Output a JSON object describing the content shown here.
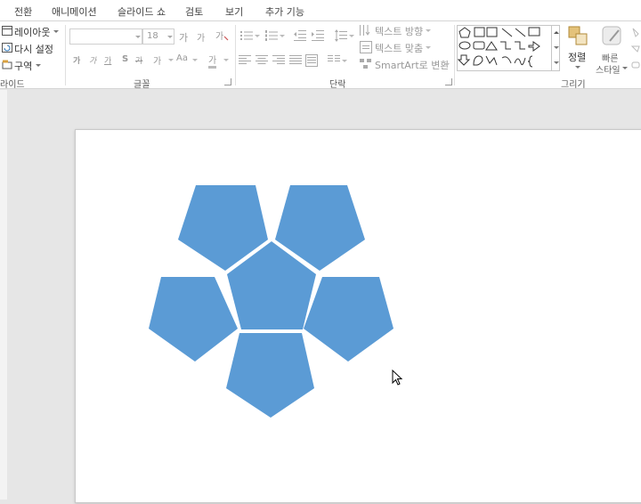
{
  "tabs": [
    "전환",
    "애니메이션",
    "슬라이드 쇼",
    "검토",
    "보기",
    "추가 기능"
  ],
  "ribbon": {
    "slides": {
      "layout": "레이아웃",
      "reset": "다시 설정",
      "section": "구역",
      "group_label": "라이드"
    },
    "font": {
      "font_size": "18",
      "grow_label": "가",
      "shrink_label": "가",
      "bold": "가",
      "italic": "가",
      "underline": "가",
      "shadow": "S",
      "strike": "가",
      "spacing": "가",
      "change_case": "Aa",
      "color": "가",
      "group_label": "글꼴"
    },
    "paragraph": {
      "text_direction": "텍스트 방향",
      "align_text": "텍스트 맞춤",
      "smartart": "SmartArt로 변환",
      "group_label": "단락"
    },
    "drawing": {
      "arrange": "정렬",
      "quick_styles": "빠른\n스타일",
      "quick_styles_line1": "빠른",
      "quick_styles_line2": "스타일",
      "group_label": "그리기"
    }
  },
  "colors": {
    "pentagon_fill": "#5b9bd5",
    "ribbon_bg": "#ffffff",
    "workarea_bg": "#e6e6e6"
  },
  "icons": [
    "pentagon-icon",
    "textbox-icon",
    "line-icon",
    "arrow-icon",
    "rectangle-icon",
    "oval-icon",
    "triangle-icon",
    "connector-icon",
    "curve-icon",
    "brace-icon",
    "arrange-icon",
    "quick-styles-icon",
    "mouse-cursor-icon"
  ]
}
